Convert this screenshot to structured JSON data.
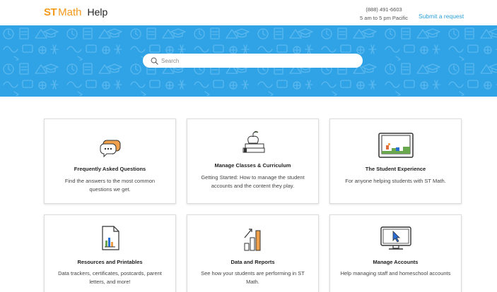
{
  "header": {
    "logo_st": "ST",
    "logo_math": "Math",
    "logo_help": "Help",
    "phone": "(888) 491-6603",
    "hours": "5 am to 5 pm Pacific",
    "submit_request": "Submit a request"
  },
  "search": {
    "placeholder": "Search"
  },
  "colors": {
    "brand_orange": "#f39a1d",
    "hero_blue": "#2fa3e6",
    "link_blue": "#2a9fd6"
  },
  "cards": [
    {
      "title": "Frequently Asked Questions",
      "description": "Find the answers to the most common questions we get.",
      "icon": "chat-bubbles-icon"
    },
    {
      "title": "Manage Classes & Curriculum",
      "description": "Getting Started: How to manage the student accounts and the content they play.",
      "icon": "apple-books-icon"
    },
    {
      "title": "The Student Experience",
      "description": "For anyone helping students with ST Math.",
      "icon": "game-screen-icon"
    },
    {
      "title": "Resources and Printables",
      "description": "Data trackers, certificates, postcards, parent letters, and more!",
      "icon": "document-chart-icon"
    },
    {
      "title": "Data and Reports",
      "description": "See how your students are performing in ST Math.",
      "icon": "bar-chart-icon"
    },
    {
      "title": "Manage Accounts",
      "description": "Help managing staff and homeschool accounts",
      "icon": "monitor-cursor-icon"
    }
  ]
}
